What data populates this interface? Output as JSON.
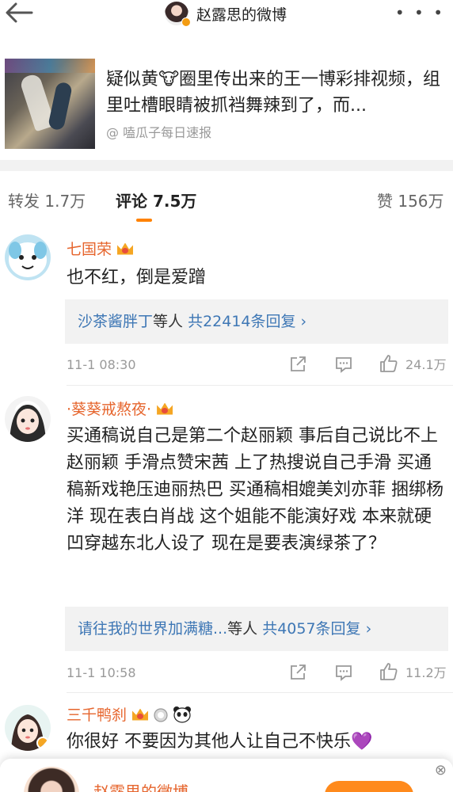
{
  "header": {
    "title": "赵露思的微博",
    "back_icon": "arrow-left-icon",
    "more_icon": "more-dots-icon"
  },
  "repost": {
    "text": "疑似黄🐮圈里传出来的王一博彩排视频，组里吐槽眼睛被抓裆舞辣到了，而...",
    "source": "@ 嗑瓜子每日速报"
  },
  "tabs": {
    "repost": "转发 1.7万",
    "comments": "评论 7.5万",
    "likes": "赞 156万"
  },
  "comments": [
    {
      "username": "七国荣",
      "content": "也不红，倒是爱蹭",
      "reply_user": "沙茶酱胖丁",
      "reply_mid": "等人",
      "reply_count": "共22414条回复 ›",
      "time": "11-1 08:30",
      "likes": "24.1万"
    },
    {
      "username": "·葵葵戒熬夜·",
      "content": "买通稿说自己是第二个赵丽颖  事后自己说比不上赵丽颖 手滑点赞宋茜 上了热搜说自己手滑 买通稿新戏艳压迪丽热巴  买通稿相媲美刘亦菲  捆绑杨洋  现在表白肖战  这个姐能不能演好戏  本来就硬凹穿越东北人设了  现在是要表演绿茶了？",
      "reply_user": "请往我的世界加满糖...",
      "reply_mid": "等人",
      "reply_count": "共4057条回复 ›",
      "time": "11-1 10:58",
      "likes": "11.2万"
    },
    {
      "username": "三千鸭刹",
      "content": "你很好  不要因为其他人让自己不快乐💜"
    }
  ],
  "float_bar": {
    "name": "赵露思的微博"
  },
  "colors": {
    "accent": "#ff8200",
    "username": "#e6652d",
    "link": "#3e77b5"
  }
}
